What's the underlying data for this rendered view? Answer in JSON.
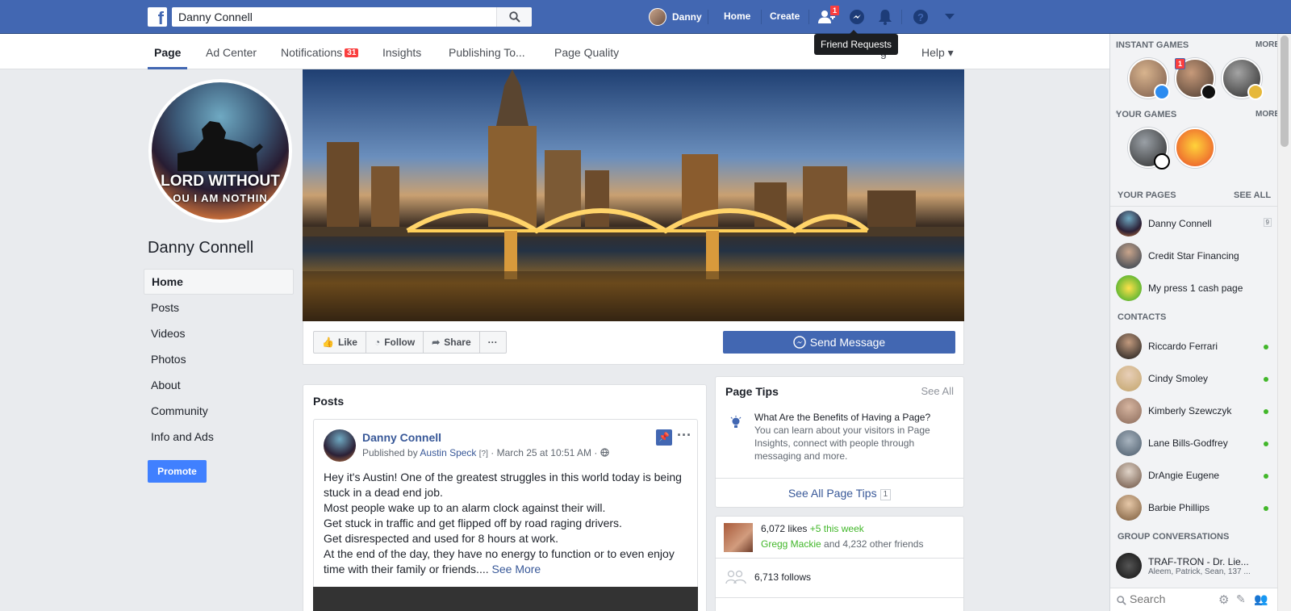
{
  "topbar": {
    "logo": "f",
    "search_value": "Danny Connell",
    "user_name": "Danny",
    "home_label": "Home",
    "create_label": "Create",
    "friend_badge": "1",
    "tooltip": "Friend Requests"
  },
  "pagebar": {
    "tabs": [
      "Page",
      "Ad Center",
      "Notifications",
      "Insights",
      "Publishing To...",
      "Page Quality"
    ],
    "notifications_badge": "31",
    "hidden_tab_fragment": "g",
    "help_label": "Help ▾"
  },
  "profile": {
    "pic_line1": "LORD WITHOUT",
    "pic_line2": "OU I AM NOTHIN",
    "page_name": "Danny Connell"
  },
  "leftnav": [
    "Home",
    "Posts",
    "Videos",
    "Photos",
    "About",
    "Community",
    "Info and Ads"
  ],
  "promote_label": "Promote",
  "actions": {
    "like": "Like",
    "follow": "Follow",
    "share": "Share",
    "more": "···",
    "send_message": "Send Message"
  },
  "posts": {
    "title": "Posts",
    "author": "Danny Connell",
    "published_by_prefix": "Published by",
    "published_by": "Austin Speck",
    "qmark": "[?]",
    "date": "· March 25 at 10:51 AM ·",
    "lines": [
      "Hey it's Austin! One of the greatest struggles in this world today is being stuck in a dead end job.",
      "Most people wake up to an alarm clock against their will.",
      "Get stuck in traffic and get flipped off by road raging drivers.",
      "Get disrespected and used for 8 hours at work.",
      "At the end of the day, they have no energy to function or to even enjoy time with their family or friends...."
    ],
    "see_more": "See More"
  },
  "tips": {
    "title": "Page Tips",
    "see_all": "See All",
    "heading": "What Are the Benefits of Having a Page?",
    "body": "You can learn about your visitors in Page Insights, connect with people through messaging and more.",
    "footer": "See All Page Tips",
    "footer_count": "1"
  },
  "stats": {
    "likes": "6,072 likes",
    "likes_week": "+5 this week",
    "friend_name": "Gregg Mackie",
    "friends_suffix": "and 4,232 other friends",
    "follows": "6,713 follows"
  },
  "sidebar": {
    "instant_games": "INSTANT GAMES",
    "more": "MORE",
    "games_badge": "1",
    "your_games": "YOUR GAMES",
    "your_pages": "YOUR PAGES",
    "see_all": "SEE ALL",
    "pages": [
      "Danny Connell",
      "Credit Star Financing",
      "My press 1 cash page"
    ],
    "page_badge": "9",
    "contacts_label": "CONTACTS",
    "contacts": [
      "Riccardo Ferrari",
      "Cindy Smoley",
      "Kimberly Szewczyk",
      "Lane Bills-Godfrey",
      "DrAngie Eugene",
      "Barbie Phillips"
    ],
    "group_label": "GROUP CONVERSATIONS",
    "group_name": "TRAF-TRON - Dr. Lie...",
    "group_members": "Aleem, Patrick, Sean, 137 ...",
    "search_placeholder": "Search"
  }
}
